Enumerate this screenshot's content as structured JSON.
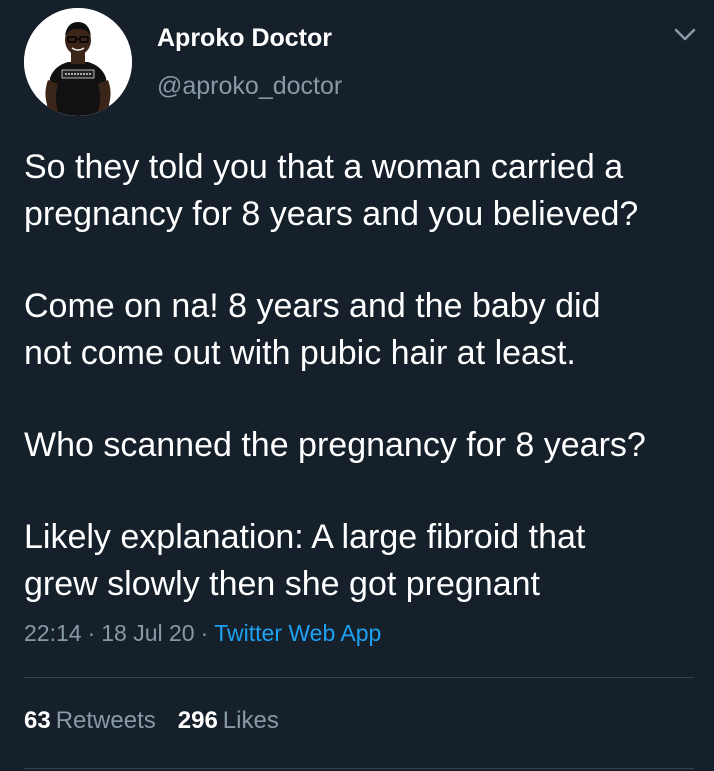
{
  "author": {
    "name": "Aproko Doctor",
    "handle": "@aproko_doctor",
    "avatar_icon": "profile-photo",
    "shirt_text": "I'M APROKO"
  },
  "menu_icon": "chevron-down-icon",
  "tweet": {
    "paragraphs": [
      [
        "So they told you that a woman carried a",
        "pregnancy for 8 years and you believed?"
      ],
      [
        "Come on na! 8 years and the baby did",
        "not come out with pubic hair at least."
      ],
      [
        "Who scanned the pregnancy for 8 years?"
      ],
      [
        "Likely explanation: A large fibroid that",
        "grew slowly then she got pregnant"
      ]
    ]
  },
  "meta": {
    "time": "22:14",
    "separator": "·",
    "date": "18 Jul 20",
    "source": "Twitter Web App"
  },
  "stats": {
    "retweets_count": "63",
    "retweets_label": "Retweets",
    "likes_count": "296",
    "likes_label": "Likes"
  },
  "colors": {
    "background": "#15202b",
    "text_primary": "#ffffff",
    "text_secondary": "#8899a6",
    "accent": "#1da1f2",
    "divider": "#38444d"
  }
}
